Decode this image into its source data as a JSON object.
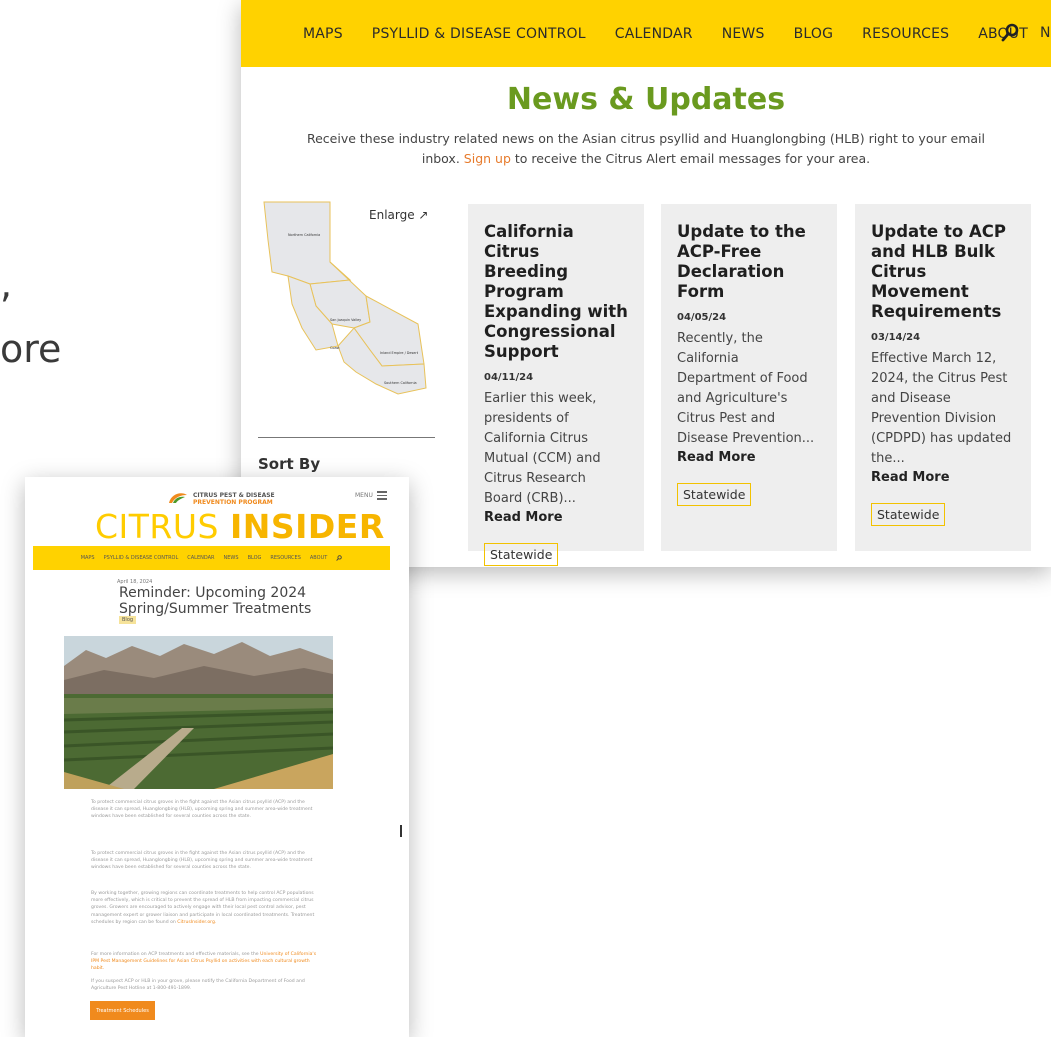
{
  "background": {
    "fragment_1": ",",
    "fragment_2": "ore"
  },
  "news": {
    "nav": [
      "MAPS",
      "PSYLLID & DISEASE CONTROL",
      "CALENDAR",
      "NEWS",
      "BLOG",
      "RESOURCES",
      "ABOUT"
    ],
    "nav_cut": "N",
    "search_icon": "search-icon",
    "title": "News & Updates",
    "intro_pre": "Receive these industry related news on the Asian citrus psyllid and Huanglongbing (HLB) right to your email inbox.",
    "intro_link": "Sign up",
    "intro_post": "to receive the Citrus Alert email messages for your area.",
    "enlarge": "Enlarge ↗",
    "map_regions": [
      "Northern California",
      "San Joaquin Valley",
      "Coast",
      "Inland Empire / Desert",
      "Southern California"
    ],
    "sort_by": "Sort By",
    "cards": [
      {
        "title": "California Citrus Breeding Program Expanding with Congressional Support",
        "date": "04/11/24",
        "excerpt": "Earlier this week, presidents of California Citrus Mutual (CCM) and Citrus Research Board (CRB)...",
        "read_more": "Read More",
        "tag": "Statewide"
      },
      {
        "title": "Update to the ACP-Free Declaration Form",
        "date": "04/05/24",
        "excerpt": "Recently, the California Department of Food and Agriculture's Citrus Pest and Disease Prevention...",
        "read_more": "Read More",
        "tag": "Statewide"
      },
      {
        "title": "Update to ACP and HLB Bulk Citrus Movement Requirements",
        "date": "03/14/24",
        "excerpt": "Effective March 12, 2024, the Citrus Pest and Disease Prevention Division (CPDPD) has updated the...",
        "read_more": "Read More",
        "tag": "Statewide"
      }
    ],
    "accent": "#ffd200",
    "title_color": "#6a9a1f",
    "link_color": "#e77b2c"
  },
  "insider": {
    "logo_line1": "CITRUS PEST & DISEASE",
    "logo_line2": "PREVENTION PROGRAM",
    "menu": "MENU",
    "wordmark_light": "CITRUS",
    "wordmark_bold": "INSIDER",
    "nav": [
      "MAPS",
      "PSYLLID & DISEASE CONTROL",
      "CALENDAR",
      "NEWS",
      "BLOG",
      "RESOURCES",
      "ABOUT"
    ],
    "date": "April 18, 2024",
    "title": "Reminder: Upcoming 2024 Spring/Summer Treatments",
    "chip": "Blog",
    "paragraphs": [
      "To protect commercial citrus groves in the fight against the Asian citrus psyllid (ACP) and the disease it can spread, Huanglongbing (HLB), upcoming spring and summer area-wide treatment windows have been established for several counties across the state.",
      "To protect commercial citrus groves in the fight against the Asian citrus psyllid (ACP) and the disease it can spread, Huanglongbing (HLB), upcoming spring and summer area-wide treatment windows have been established for several counties across the state.",
      "By working together, growing regions can coordinate treatments to help control ACP populations more effectively, which is critical to prevent the spread of HLB from impacting commercial citrus groves. Growers are encouraged to actively engage with their local pest control advisor, pest management expert or grower liaison and participate in local coordinated treatments. Treatment schedules by region can be found on",
      "For more information on ACP treatments and effective materials, see the",
      "If you suspect ACP or HLB in your grove, please notify the California Department of Food and Agriculture Pest Hotline at 1-800-491-1899."
    ],
    "para3_link": "CitrusInsider.org.",
    "para4_link": "University of California's IPM Pest Management Guidelines for Asian Citrus Psyllid on activities with each cultural growth habit.",
    "button": "Treatment Schedules"
  }
}
